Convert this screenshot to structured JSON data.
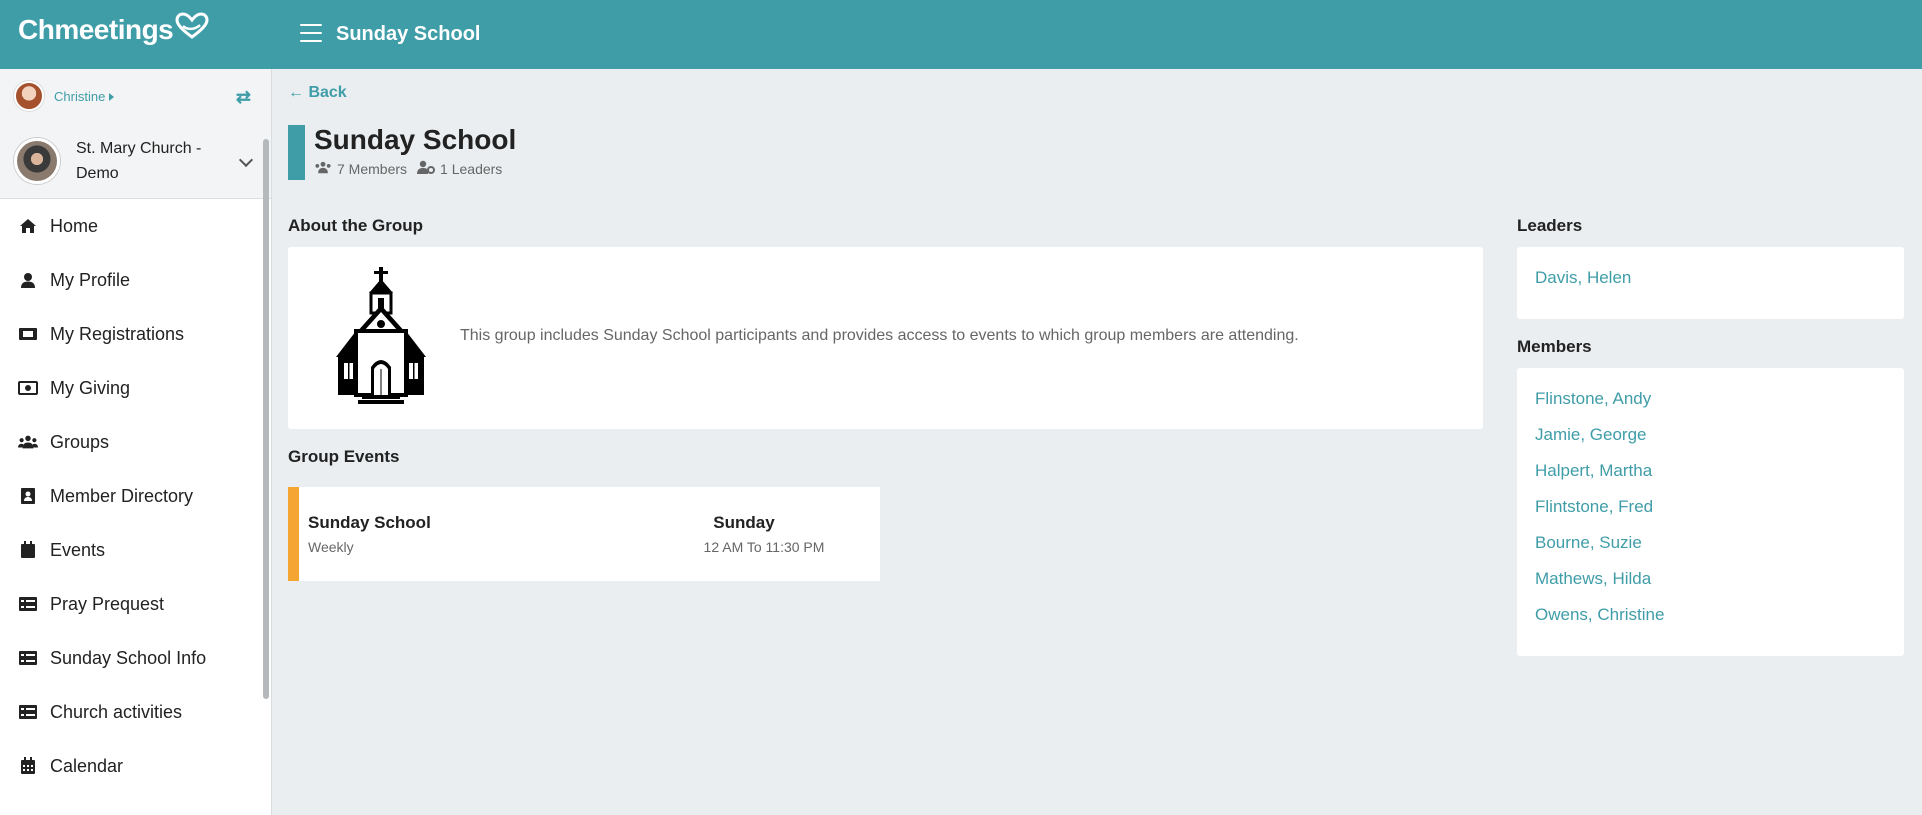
{
  "app": {
    "logo_text": "Chmeetings",
    "title": "Sunday School"
  },
  "sidebar": {
    "user_name": "Christine",
    "church_name": "St. Mary Church - Demo",
    "items": [
      {
        "label": "Home",
        "icon": "home-icon"
      },
      {
        "label": "My Profile",
        "icon": "user-icon"
      },
      {
        "label": "My Registrations",
        "icon": "ticket-icon"
      },
      {
        "label": "My Giving",
        "icon": "money-icon"
      },
      {
        "label": "Groups",
        "icon": "users-icon"
      },
      {
        "label": "Member Directory",
        "icon": "address-book-icon"
      },
      {
        "label": "Events",
        "icon": "calendar-icon"
      },
      {
        "label": "Pray Prequest",
        "icon": "list-icon"
      },
      {
        "label": "Sunday School Info",
        "icon": "list-icon"
      },
      {
        "label": "Church activities",
        "icon": "list-icon"
      },
      {
        "label": "Calendar",
        "icon": "calendar-grid-icon"
      }
    ]
  },
  "main": {
    "back_label": "Back",
    "group_title": "Sunday School",
    "members_count": "7 Members",
    "leaders_count": "1 Leaders",
    "about_heading": "About the Group",
    "about_text": "This group includes Sunday School participants and provides access to events to which group members are attending.",
    "events_heading": "Group Events",
    "event": {
      "name": "Sunday School",
      "frequency": "Weekly",
      "day": "Sunday",
      "time": "12 AM To 11:30 PM"
    },
    "leaders_heading": "Leaders",
    "leaders": [
      "Davis, Helen"
    ],
    "members_heading": "Members",
    "members": [
      "Flinstone, Andy",
      "Jamie, George",
      "Halpert, Martha",
      "Flintstone, Fred",
      "Bourne, Suzie",
      "Mathews, Hilda",
      "Owens, Christine"
    ]
  },
  "colors": {
    "accent": "#3f9da8",
    "event_bar": "#f5a632",
    "background": "#eaeef0"
  }
}
